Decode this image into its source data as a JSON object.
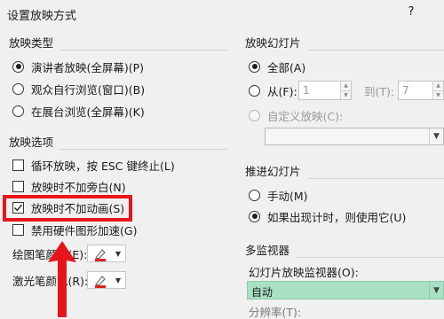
{
  "dialog": {
    "title": "设置放映方式",
    "help": "?"
  },
  "show_type": {
    "title": "放映类型",
    "options": [
      {
        "label": "演讲者放映(全屏幕)(P)",
        "checked": true
      },
      {
        "label": "观众自行浏览(窗口)(B)",
        "checked": false
      },
      {
        "label": "在展台浏览(全屏幕)(K)",
        "checked": false
      }
    ]
  },
  "show_options": {
    "title": "放映选项",
    "checkboxes": [
      {
        "label": "循环放映，按 ESC 键终止(L)",
        "checked": false
      },
      {
        "label": "放映时不加旁白(N)",
        "checked": false
      },
      {
        "label": "放映时不加动画(S)",
        "checked": true
      },
      {
        "label": "禁用硬件图形加速(G)",
        "checked": false
      }
    ],
    "pen_color_label": "绘图笔颜色(E):",
    "laser_color_label": "激光笔颜色(R):",
    "pen_color": "#e02020",
    "laser_color": "#e02020"
  },
  "slides": {
    "title": "放映幻灯片",
    "all_label": "全部(A)",
    "from_label": "从(F):",
    "from_value": "1",
    "to_label": "到(T):",
    "to_value": "7",
    "custom_label": "自定义放映(C):"
  },
  "advance": {
    "title": "推进幻灯片",
    "manual_label": "手动(M)",
    "timing_label": "如果出现计时，则使用它(U)"
  },
  "monitors": {
    "title": "多监视器",
    "monitor_label": "幻灯片放映监视器(O):",
    "monitor_value": "自动",
    "resolution_label": "分辨率(T):"
  },
  "colors": {
    "highlight": "#e8141b",
    "selected_combo": "#a8e0c4"
  }
}
